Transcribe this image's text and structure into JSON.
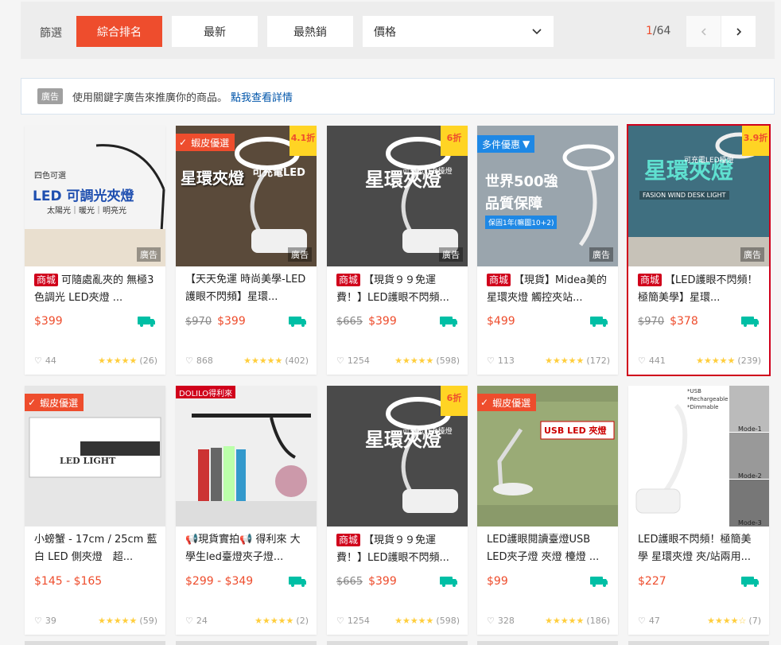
{
  "filter": {
    "label": "篩選",
    "sort_options": [
      "綜合排名",
      "最新",
      "最熱銷"
    ],
    "active_sort": "綜合排名",
    "price_label": "價格",
    "page_current": "1",
    "page_total": "/64"
  },
  "ad_notice": {
    "tag": "廣告",
    "text": "使用關鍵字廣告來推廣你的商品。",
    "link": "點我查看詳情"
  },
  "labels": {
    "ad": "廣告",
    "mall": "商城",
    "preferred": "蝦皮優選",
    "multi_promo": "多件優惠",
    "dolilo": "DOLILO得利來"
  },
  "products": [
    {
      "title": "可隨處亂夾的 無極3色調光 LED夾燈 ...",
      "mall": true,
      "price": "$399",
      "original": "",
      "discount": "",
      "likes": "44",
      "rating_count": "(26)",
      "stars": 5,
      "ad": true,
      "thumb_text": "LED 可調光夾燈",
      "thumb_sub": "太陽光｜暖光｜明亮光",
      "thumb_small": "四色可選"
    },
    {
      "title": "【天天免運 時尚美學-LED護眼不閃頻】星環...",
      "mall": false,
      "price": "$399",
      "original": "$970",
      "discount": "4.1折",
      "likes": "868",
      "rating_count": "(402)",
      "stars": 5,
      "ad": true,
      "preferred": true,
      "thumb_text": "星環夾燈",
      "thumb_sub": "可充電LED"
    },
    {
      "title": "【現貨９９免運費！】LED護眼不閃頻...",
      "mall": true,
      "price": "$399",
      "original": "$665",
      "discount": "6折",
      "likes": "1254",
      "rating_count": "(598)",
      "stars": 5,
      "ad": true,
      "thumb_text": "星環夾燈",
      "thumb_sub": "可充電LED檯燈"
    },
    {
      "title": "【現貨】Midea美的星環夾燈 觸控夾站...",
      "mall": true,
      "price": "$499",
      "original": "",
      "discount": "",
      "likes": "113",
      "rating_count": "(172)",
      "stars": 5,
      "ad": true,
      "promo": true,
      "thumb_text": "世界500強",
      "thumb_sub": "品質保障",
      "thumb_small": "保固1年(嘛圖10+2)"
    },
    {
      "title": "【LED護眼不閃頻！極簡美學】星環...",
      "mall": true,
      "price": "$378",
      "original": "$970",
      "discount": "3.9折",
      "likes": "441",
      "rating_count": "(239)",
      "stars": 5,
      "ad": true,
      "highlight": true,
      "thumb_text": "星環夾燈",
      "thumb_sub": "可充電LED檯燈",
      "thumb_small": "FASION WIND DESK LIGHT"
    },
    {
      "title": "小螃蟹 - 17cm / 25cm 藍白 LED 側夾燈　超...",
      "mall": false,
      "price": "$145 - $165",
      "original": "",
      "discount": "",
      "likes": "39",
      "rating_count": "(59)",
      "stars": 5,
      "ad": false,
      "preferred": true,
      "thumb_text": "LED LIGHT"
    },
    {
      "title": "📢現貨實拍📢 得利來 大學生led臺燈夾子燈...",
      "mall": false,
      "price": "$299 - $349",
      "original": "",
      "discount": "",
      "likes": "24",
      "rating_count": "(2)",
      "stars": 5,
      "ad": false,
      "dolilo": true
    },
    {
      "title": "【現貨９９免運費！】LED護眼不閃頻...",
      "mall": true,
      "price": "$399",
      "original": "$665",
      "discount": "6折",
      "likes": "1254",
      "rating_count": "(598)",
      "stars": 5,
      "ad": false,
      "thumb_text": "星環夾燈",
      "thumb_sub": "可充電LED檯燈"
    },
    {
      "title": "LED護眼閱讀臺燈USB LED夾子燈 夾燈 檯燈 ...",
      "mall": false,
      "price": "$99",
      "original": "",
      "discount": "",
      "likes": "328",
      "rating_count": "(186)",
      "stars": 5,
      "ad": false,
      "preferred": true,
      "thumb_text": "USB LED 夾燈"
    },
    {
      "title": "LED護眼不閃頻！極簡美學 星環夾燈 夾/站兩用...",
      "mall": false,
      "price": "$227",
      "original": "",
      "discount": "",
      "likes": "47",
      "rating_count": "(7)",
      "stars": 4,
      "ad": false,
      "thumb_small": "*USB *Rechargeable *Dimmable",
      "modes": [
        "Mode-1",
        "Mode-2",
        "Mode-3"
      ]
    }
  ]
}
